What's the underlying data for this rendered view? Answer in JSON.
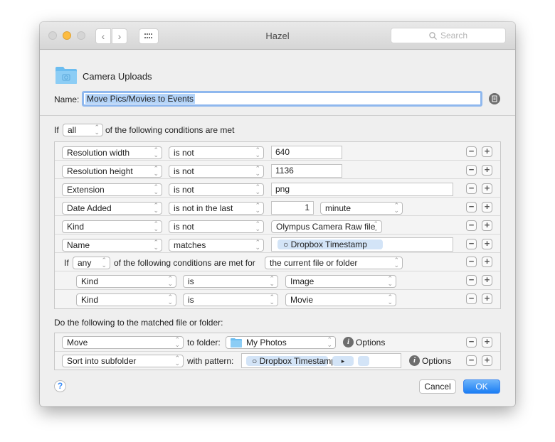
{
  "window": {
    "title": "Hazel",
    "search_placeholder": "Search",
    "nav_back": "‹",
    "nav_forward": "›",
    "grid_icon": "grid-icon"
  },
  "folder": {
    "name": "Camera Uploads",
    "icon": "camera-folder-icon"
  },
  "rule_name": {
    "label": "Name:",
    "value": "Move Pics/Movies to Events"
  },
  "conditions": {
    "if_label": "If",
    "match_mode": "all",
    "suffix": "of the following conditions are met",
    "rows": [
      {
        "attribute": "Resolution width",
        "operator": "is not",
        "value": "640"
      },
      {
        "attribute": "Resolution height",
        "operator": "is not",
        "value": "1136"
      },
      {
        "attribute": "Extension",
        "operator": "is not",
        "value": "png"
      },
      {
        "attribute": "Date Added",
        "operator": "is not in the last",
        "amount": "1",
        "unit": "minute"
      },
      {
        "attribute": "Kind",
        "operator": "is not",
        "value": "Olympus Camera Raw file"
      },
      {
        "attribute": "Name",
        "operator": "matches",
        "token": "○ Dropbox Timestamp"
      }
    ],
    "nested": {
      "if_label": "If",
      "match_mode": "any",
      "middle": "of the following conditions are met for",
      "target": "the current file or folder",
      "rows": [
        {
          "attribute": "Kind",
          "operator": "is",
          "value": "Image"
        },
        {
          "attribute": "Kind",
          "operator": "is",
          "value": "Movie"
        }
      ]
    }
  },
  "actions": {
    "header": "Do the following to the matched file or folder:",
    "rows": [
      {
        "action": "Move",
        "connector": "to folder:",
        "folder": "My Photos",
        "options": "Options"
      },
      {
        "action": "Sort into subfolder",
        "connector": "with pattern:",
        "token": "○ Dropbox Timestamp",
        "token_arrow": "▸",
        "options": "Options"
      }
    ]
  },
  "buttons": {
    "help": "?",
    "cancel": "Cancel",
    "ok": "OK"
  },
  "symbols": {
    "minus": "−",
    "plus": "+",
    "updown": "⌃⌄"
  },
  "colors": {
    "accent": "#3d8ef8",
    "token": "#d3e4f7",
    "selection": "#b3d3f8"
  }
}
